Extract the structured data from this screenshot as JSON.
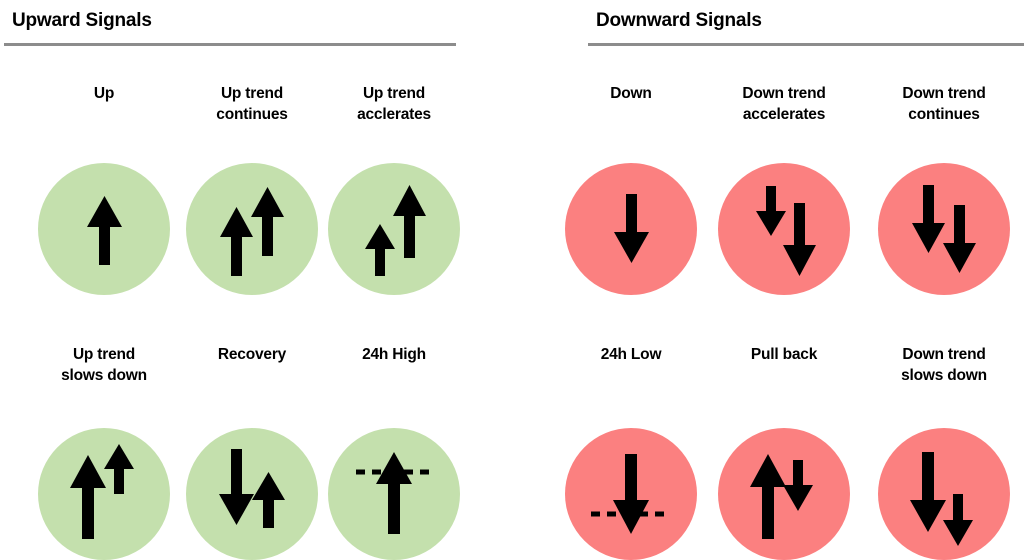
{
  "panels": [
    {
      "title": "Upward Signals",
      "accent_color": "#c4e0ad",
      "rule_color": "#8c8c8c"
    },
    {
      "title": "Downward Signals",
      "accent_color": "#fb8080",
      "rule_color": "#8c8c8c"
    }
  ],
  "signals": {
    "up_1": {
      "label": "Up",
      "icon": "arrow-up-single",
      "circle_color": "#c4e0ad"
    },
    "up_2": {
      "label": "Up trend\ncontinues",
      "icon": "arrows-up-step-up",
      "circle_color": "#c4e0ad"
    },
    "up_3": {
      "label": "Up trend\nacclerates",
      "icon": "arrows-up-accelerate",
      "circle_color": "#c4e0ad"
    },
    "up_4": {
      "label": "Up trend\nslows down",
      "icon": "arrows-up-slow-down",
      "circle_color": "#c4e0ad"
    },
    "up_5": {
      "label": "Recovery",
      "icon": "arrow-down-then-up",
      "circle_color": "#c4e0ad"
    },
    "up_6": {
      "label": "24h High",
      "icon": "arrow-up-dashed-line",
      "circle_color": "#c4e0ad"
    },
    "down_1": {
      "label": "Down",
      "icon": "arrow-down-single",
      "circle_color": "#fb8080"
    },
    "down_2": {
      "label": "Down trend\naccelerates",
      "icon": "arrows-down-accelerate",
      "circle_color": "#fb8080"
    },
    "down_3": {
      "label": "Down trend\ncontinues",
      "icon": "arrows-down-step-down",
      "circle_color": "#fb8080"
    },
    "down_4": {
      "label": "24h Low",
      "icon": "arrow-down-dashed-line",
      "circle_color": "#fb8080"
    },
    "down_5": {
      "label": "Pull back",
      "icon": "arrow-up-then-down",
      "circle_color": "#fb8080"
    },
    "down_6": {
      "label": "Down trend\nslows down",
      "icon": "arrows-down-slow-down",
      "circle_color": "#fb8080"
    }
  }
}
